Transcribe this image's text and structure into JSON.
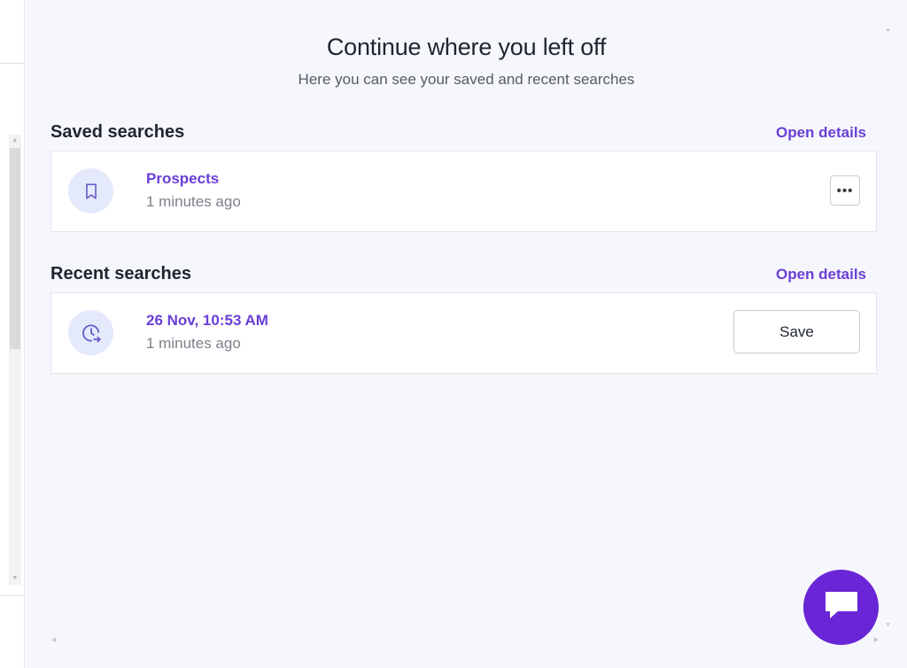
{
  "panel": {
    "title": "Continue where you left off",
    "subtitle": "Here you can see your saved and recent searches"
  },
  "saved": {
    "section_title": "Saved searches",
    "open_details_label": "Open details",
    "items": [
      {
        "title": "Prospects",
        "time": "1 minutes ago",
        "icon": "bookmark-icon",
        "more_label": "•••"
      }
    ]
  },
  "recent": {
    "section_title": "Recent searches",
    "open_details_label": "Open details",
    "items": [
      {
        "title": "26 Nov, 10:53 AM",
        "time": "1 minutes ago",
        "icon": "clock-history-icon",
        "save_label": "Save"
      }
    ]
  },
  "chat": {
    "icon": "chat-bubble-icon"
  },
  "colors": {
    "accent": "#6a3fd6",
    "chat_button": "#6a25d6",
    "panel_background": "#f6f7fc",
    "icon_circle": "#e4e9fb"
  }
}
